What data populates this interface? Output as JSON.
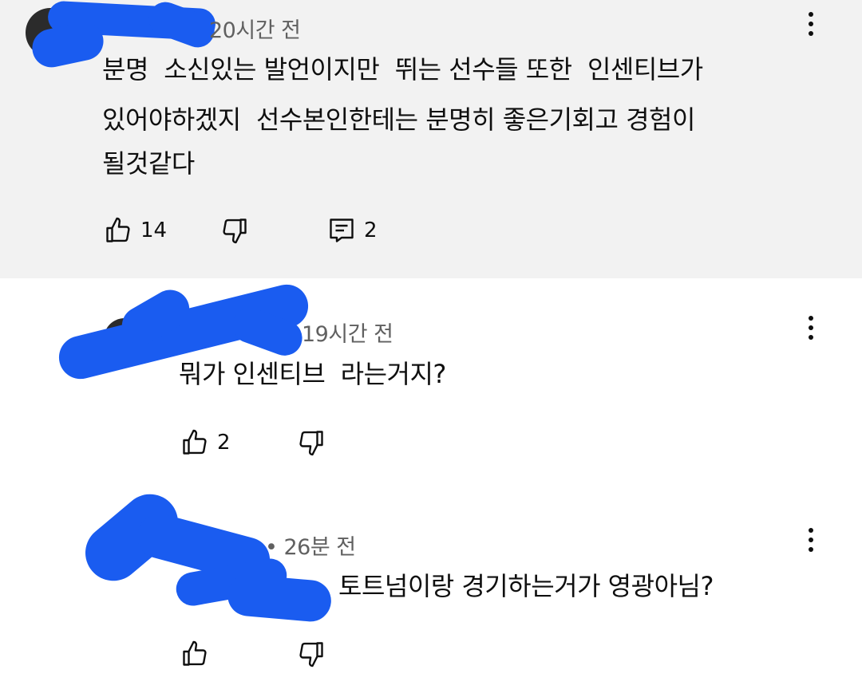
{
  "comments": [
    {
      "time": "20시간 전",
      "text_lines": [
        "분명  소신있는 발언이지만  뛰는 선수들 또한  인센티브가",
        "있어야하겠지  선수본인한테는 분명히 좋은기회고 경험이",
        "될것같다"
      ],
      "likes": "14",
      "replies": "2",
      "highlighted": true
    },
    {
      "time": "19시간 전",
      "text_lines": [
        "뭐가 인센티브  라는거지?"
      ],
      "likes": "2"
    },
    {
      "time": "• 26분 전",
      "text_lines": [
        "토트넘이랑 경기하는거가 영광아님?"
      ],
      "likes": ""
    }
  ],
  "icons": {
    "like": "thumb-up-icon",
    "dislike": "thumb-down-icon",
    "reply": "reply-comment-icon",
    "menu": "more-vert-icon"
  },
  "colors": {
    "highlight_bg": "#f2f2f2",
    "redaction": "#1a5cf0",
    "meta_text": "#606060"
  }
}
